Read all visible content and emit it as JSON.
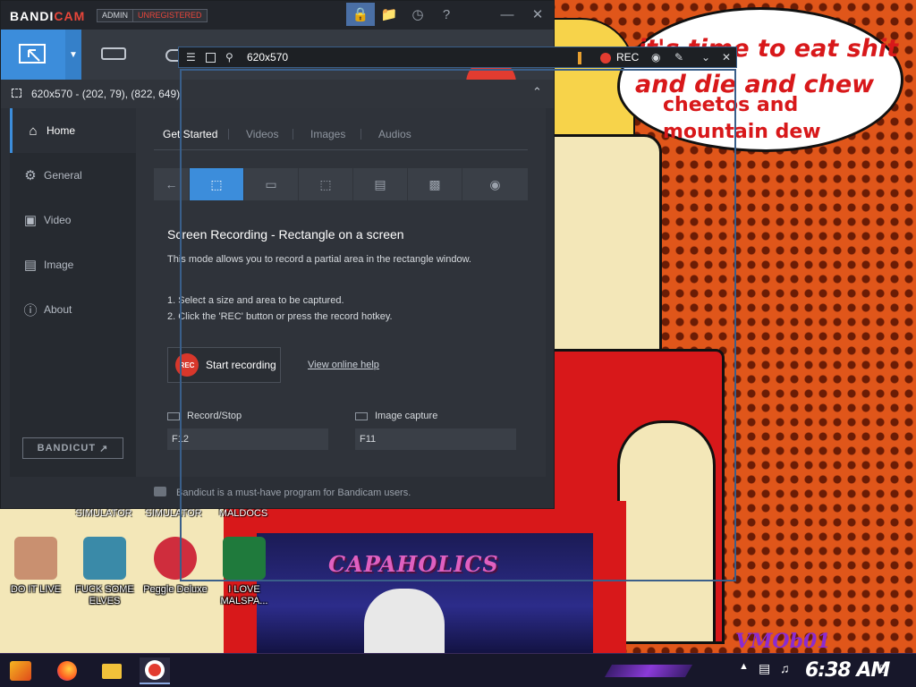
{
  "wallpaper": {
    "bubble_line1": "it's time to eat shit",
    "bubble_line2": "and die and chew",
    "bubble_line3": "cheetos and",
    "bubble_line4": "mountain dew",
    "album_title": "CAPAHOLICS",
    "signature": "VMOb01"
  },
  "desktop": {
    "top_labels": [
      "SIMULATOR",
      "SIMULATOR",
      "MALDOCS"
    ],
    "icons": [
      {
        "label": "DO IT LIVE",
        "color": "#c99070"
      },
      {
        "label": "FUCK SOME ELVES",
        "color": "#3a8aa8"
      },
      {
        "label": "Peggle Deluxe",
        "color": "#cf2d3d"
      },
      {
        "label": "I LOVE MALSPA...",
        "color": "#1f7a3c"
      }
    ]
  },
  "bandicam": {
    "logo_a": "BANDI",
    "logo_b": "CAM",
    "badge_admin": "ADMIN",
    "badge_unreg": "UNREGISTERED",
    "area_text": "620x570 - (202, 79), (822, 649)",
    "sidebar": [
      {
        "label": "Home",
        "icon": "home-icon"
      },
      {
        "label": "General",
        "icon": "gear-icon"
      },
      {
        "label": "Video",
        "icon": "video-icon"
      },
      {
        "label": "Image",
        "icon": "image-icon"
      },
      {
        "label": "About",
        "icon": "info-icon"
      }
    ],
    "bandicut_label": "BANDICUT",
    "tabs": [
      "Get Started",
      "Videos",
      "Images",
      "Audios"
    ],
    "content_title": "Screen Recording - Rectangle on a screen",
    "content_desc": "This mode allows you to record a partial area in the rectangle window.",
    "step1": "1. Select a size and area to be captured.",
    "step2": "2. Click the 'REC' button or press the record hotkey.",
    "rec_badge": "REC",
    "start_recording": "Start recording",
    "online_help": "View online help",
    "hk_record_label": "Record/Stop",
    "hk_record_value": "F12",
    "hk_image_label": "Image capture",
    "hk_image_value": "F11",
    "footer_text": "Bandicut is a must-have program for Bandicam users.",
    "accent_color": "#3c8ddb",
    "rec_color": "#d8372b"
  },
  "capture_bar": {
    "size": "620x570",
    "rec_label": "REC"
  },
  "taskbar": {
    "clock": "6:38 AM"
  }
}
